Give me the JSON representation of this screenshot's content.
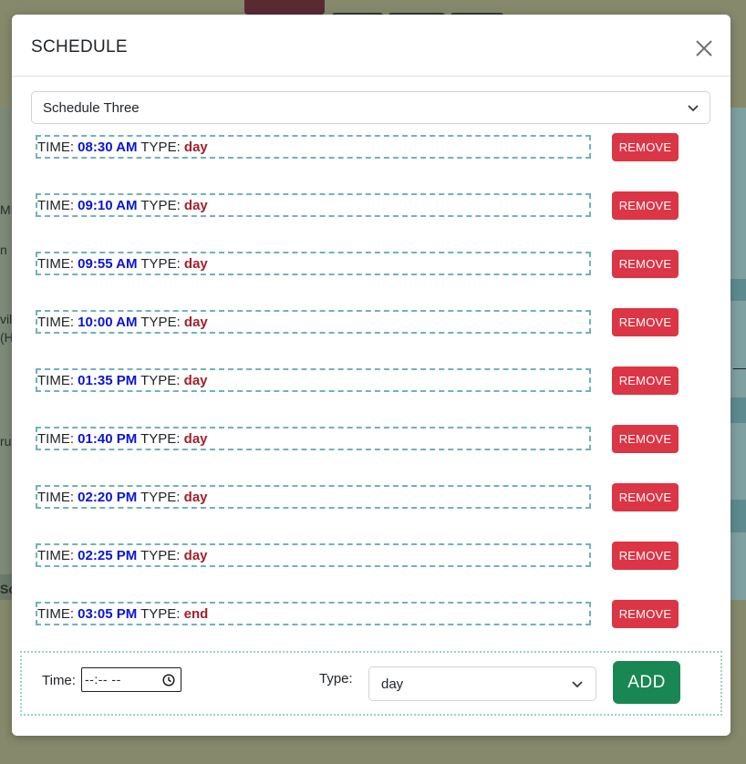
{
  "modal": {
    "title": "SCHEDULE",
    "close_icon": "close-icon"
  },
  "schedule_select": {
    "selected": "Schedule Three",
    "icon": "chevron-down-icon"
  },
  "entries": [
    {
      "time_label": "TIME:",
      "time": "08:30 AM",
      "type_label": "TYPE:",
      "type": "day",
      "remove_label": "REMOVE"
    },
    {
      "time_label": "TIME:",
      "time": "09:10 AM",
      "type_label": "TYPE:",
      "type": "day",
      "remove_label": "REMOVE"
    },
    {
      "time_label": "TIME:",
      "time": "09:55 AM",
      "type_label": "TYPE:",
      "type": "day",
      "remove_label": "REMOVE"
    },
    {
      "time_label": "TIME:",
      "time": "10:00 AM",
      "type_label": "TYPE:",
      "type": "day",
      "remove_label": "REMOVE"
    },
    {
      "time_label": "TIME:",
      "time": "01:35 PM",
      "type_label": "TYPE:",
      "type": "day",
      "remove_label": "REMOVE"
    },
    {
      "time_label": "TIME:",
      "time": "01:40 PM",
      "type_label": "TYPE:",
      "type": "day",
      "remove_label": "REMOVE"
    },
    {
      "time_label": "TIME:",
      "time": "02:20 PM",
      "type_label": "TYPE:",
      "type": "day",
      "remove_label": "REMOVE"
    },
    {
      "time_label": "TIME:",
      "time": "02:25 PM",
      "type_label": "TYPE:",
      "type": "day",
      "remove_label": "REMOVE"
    },
    {
      "time_label": "TIME:",
      "time": "03:05 PM",
      "type_label": "TYPE:",
      "type": "end",
      "remove_label": "REMOVE"
    }
  ],
  "add_form": {
    "time_label": "Time:",
    "time_value": "--:-- --",
    "clock_icon": "clock-icon",
    "type_label": "Type:",
    "type_selected": "day",
    "add_label": "ADD"
  },
  "colors": {
    "time_value": "#0a14d6",
    "type_value": "#a3202a",
    "remove_button": "#dc3545",
    "add_button": "#198754",
    "entry_border": "#6fb3b8",
    "overlay_background": "#86896c"
  },
  "background": {
    "left_fragments": [
      "MP",
      "n",
      "vil",
      "(H",
      "rui",
      "Sc"
    ]
  }
}
